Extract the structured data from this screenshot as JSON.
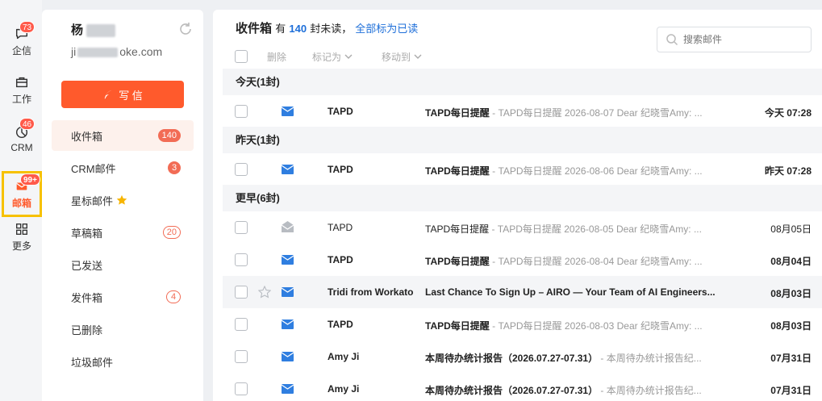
{
  "rail": [
    {
      "label": "企信",
      "icon": "chat-icon",
      "badge": "73"
    },
    {
      "label": "工作",
      "icon": "briefcase-icon",
      "badge": ""
    },
    {
      "label": "CRM",
      "icon": "chart-pie-icon",
      "badge": "46"
    },
    {
      "label": "邮箱",
      "icon": "mail-icon",
      "badge": "99+"
    },
    {
      "label": "更多",
      "icon": "grid-icon",
      "badge": ""
    }
  ],
  "user": {
    "name": "杨",
    "email_prefix": "ji",
    "email_suffix": "oke.com"
  },
  "compose_label": "写 信",
  "folders": [
    {
      "label": "收件箱",
      "count": "140"
    },
    {
      "label": "CRM邮件",
      "count": "3"
    },
    {
      "label": "星标邮件",
      "count": ""
    },
    {
      "label": "草稿箱",
      "count": "20"
    },
    {
      "label": "已发送",
      "count": ""
    },
    {
      "label": "发件箱",
      "count": "4"
    },
    {
      "label": "已删除",
      "count": ""
    },
    {
      "label": "垃圾邮件",
      "count": ""
    }
  ],
  "header": {
    "title": "收件箱",
    "has": "有",
    "unread": "140",
    "unread_suffix": "封未读，",
    "mark_all": "全部标为已读"
  },
  "search": {
    "placeholder": "搜索邮件"
  },
  "toolbar": {
    "delete": "删除",
    "mark_as": "标记为",
    "move_to": "移动到"
  },
  "groups": [
    {
      "label": "今天(1封)"
    },
    {
      "label": "昨天(1封)"
    },
    {
      "label": "更早(6封)"
    }
  ],
  "mails": [
    {
      "sender": "TAPD",
      "subject": "TAPD每日提醒",
      "preview": " - TAPD每日提醒 2026-08-07 Dear 纪晓雪Amy: ...",
      "date": "今天 07:28"
    },
    {
      "sender": "TAPD",
      "subject": "TAPD每日提醒",
      "preview": " - TAPD每日提醒 2026-08-06 Dear 纪晓雪Amy: ...",
      "date": "昨天 07:28"
    },
    {
      "sender": "TAPD",
      "subject": "TAPD每日提醒",
      "preview": " - TAPD每日提醒 2026-08-05 Dear 纪晓雪Amy: ...",
      "date": "08月05日"
    },
    {
      "sender": "TAPD",
      "subject": "TAPD每日提醒",
      "preview": " - TAPD每日提醒 2026-08-04 Dear 纪晓雪Amy: ...",
      "date": "08月04日"
    },
    {
      "sender": "Tridi from Workato",
      "subject": "Last Chance To Sign Up – AIRO — Your Team of AI Engineers...",
      "preview": "",
      "date": "08月03日"
    },
    {
      "sender": "TAPD",
      "subject": "TAPD每日提醒",
      "preview": " - TAPD每日提醒 2026-08-03 Dear 纪晓雪Amy: ...",
      "date": "08月03日"
    },
    {
      "sender": "Amy Ji",
      "subject": "本周待办统计报告（2026.07.27-07.31）",
      "preview": " - 本周待办统计报告纪...",
      "date": "07月31日"
    },
    {
      "sender": "Amy Ji",
      "subject": "本周待办统计报告（2026.07.27-07.31）",
      "preview": " - 本周待办统计报告纪...",
      "date": "07月31日"
    }
  ],
  "colors": {
    "accent": "#ff5a2c",
    "link": "#1e6fd9",
    "badge": "#f26c55",
    "highlight": "#f7c100"
  }
}
